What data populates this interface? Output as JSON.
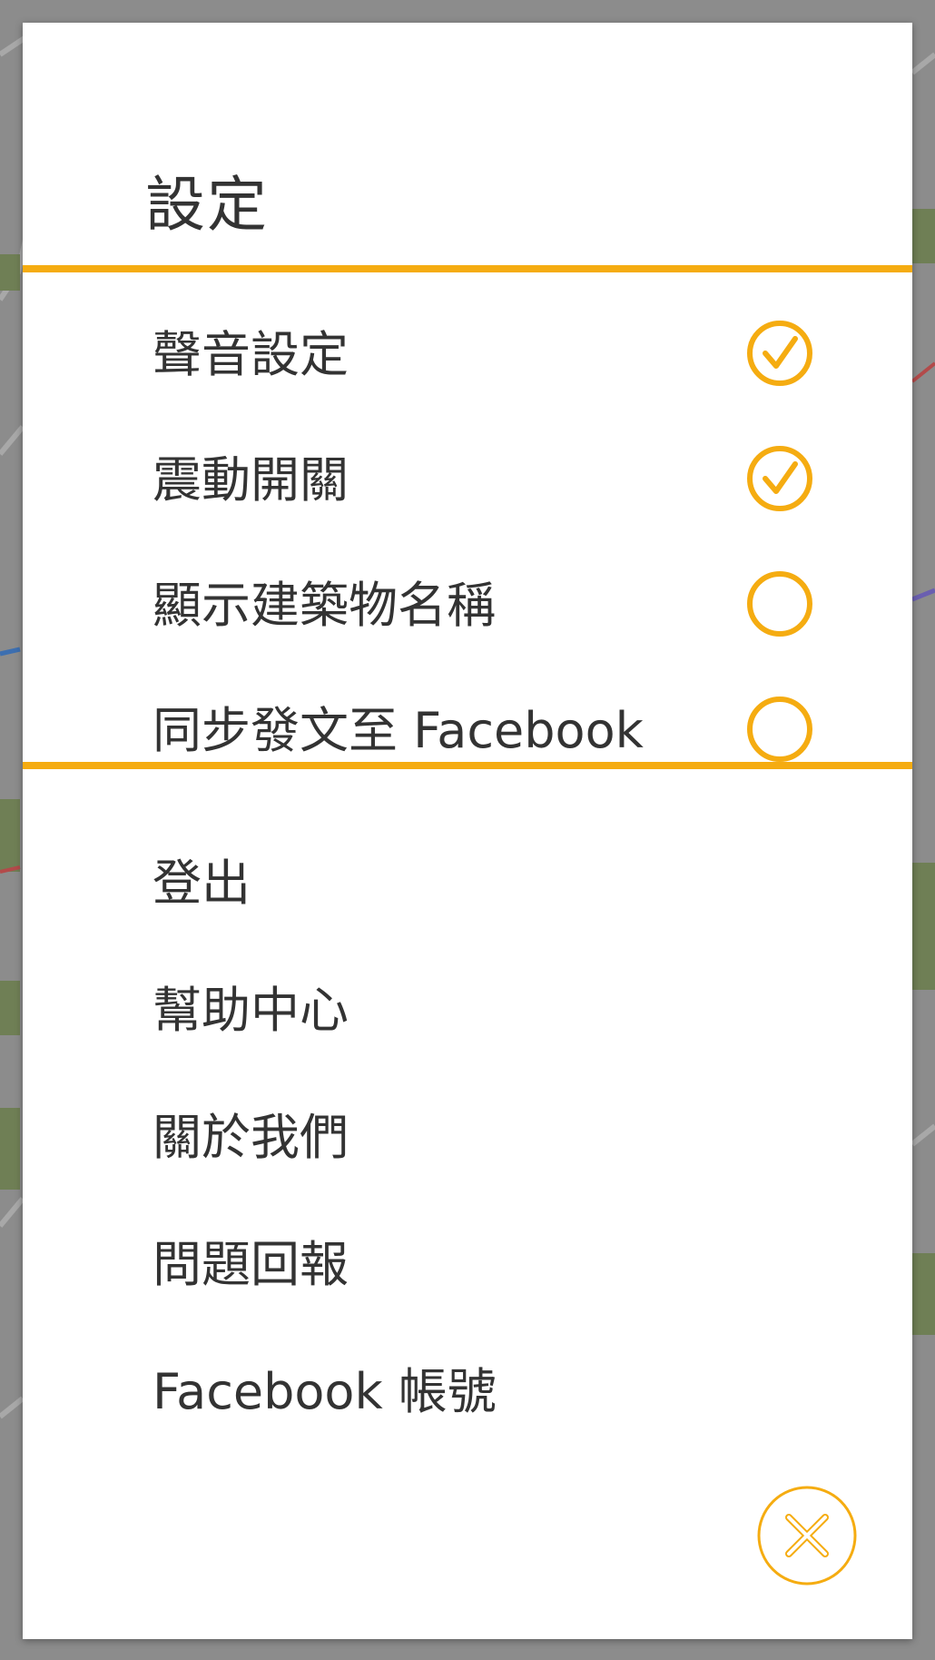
{
  "colors": {
    "accent": "#F5AC11",
    "text": "#333333",
    "dialog_bg": "#FFFFFF",
    "backdrop": "#8A8A8A"
  },
  "dialog": {
    "title": "設定",
    "toggles": [
      {
        "label": "聲音設定",
        "checked": true,
        "icon": "check-circle-icon"
      },
      {
        "label": "震動開關",
        "checked": true,
        "icon": "check-circle-icon"
      },
      {
        "label": "顯示建築物名稱",
        "checked": false,
        "icon": "empty-circle-icon"
      },
      {
        "label": "同步發文至 Facebook",
        "checked": false,
        "icon": "empty-circle-icon"
      }
    ],
    "menu": [
      {
        "label": "登出"
      },
      {
        "label": "幫助中心"
      },
      {
        "label": "關於我們"
      },
      {
        "label": "問題回報"
      },
      {
        "label": "Facebook 帳號"
      }
    ],
    "close_icon": "close-icon"
  }
}
